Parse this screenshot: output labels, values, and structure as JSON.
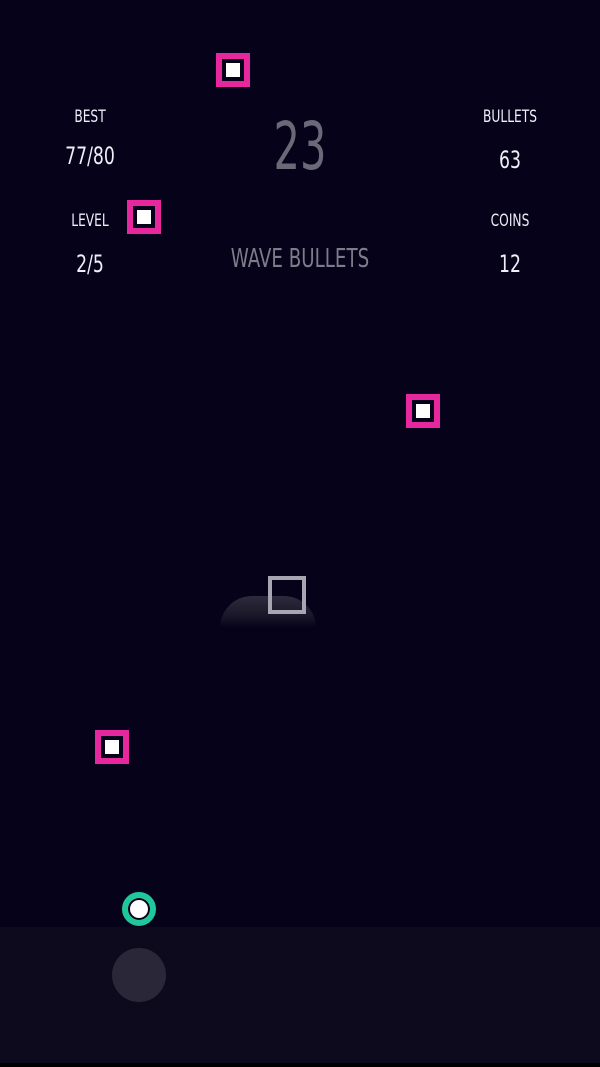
{
  "hud": {
    "best_label": "BEST",
    "best_value": "77/80",
    "level_label": "LEVEL",
    "level_value": "2/5",
    "bullets_label": "BULLETS",
    "bullets_value": "63",
    "coins_label": "COINS",
    "coins_value": "12"
  },
  "score": "23",
  "wave": {
    "title": "WAVE BULLETS"
  },
  "colors": {
    "background": "#05021a",
    "enemy_border": "#e6279e",
    "player_ring": "#1fc79a",
    "bottom_panel": "#0c0a1c"
  },
  "icons": {
    "enemy": "magenta-square-enemy-icon",
    "player": "green-ring-player-icon",
    "turret": "outline-square-turret-icon",
    "joystick": "joystick-knob-icon"
  }
}
